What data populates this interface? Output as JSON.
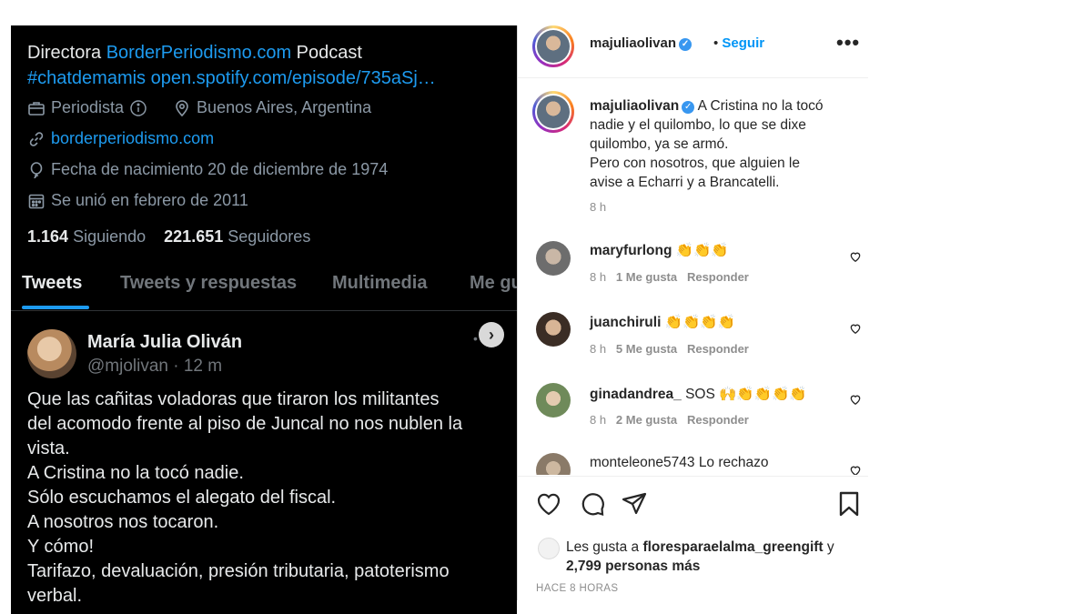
{
  "twitter": {
    "bio_line1_prefix": "Directora ",
    "bio_line1_link": "BorderPeriodismo.com",
    "bio_line1_suffix": " Podcast",
    "bio_line2": "#chatdemamis open.spotify.com/episode/735aSj…",
    "occupation": "Periodista",
    "location": "Buenos Aires, Argentina",
    "website": "borderperiodismo.com",
    "birthdate": "Fecha de nacimiento 20 de diciembre de 1974",
    "joined": "Se unió en febrero de 2011",
    "following_count": "1.164",
    "following_label": "Siguiendo",
    "followers_count": "221.651",
    "followers_label": "Seguidores",
    "tabs": [
      "Tweets",
      "Tweets y respuestas",
      "Multimedia",
      "Me gu"
    ],
    "tweet": {
      "author_name": "María Julia Oliván",
      "author_handle": "@mjolivan · 12 m",
      "lines": [
        "Que las cañitas voladoras que tiraron los militantes",
        "del acomodo frente al piso de Juncal  no nos nublen la",
        "vista.",
        "A Cristina no la tocó nadie.",
        "Sólo escuchamos el alegato del fiscal.",
        "A nosotros nos tocaron.",
        "Y cómo!",
        "Tarifazo, devaluación, presión tributaria, patoterismo",
        "verbal."
      ]
    }
  },
  "instagram": {
    "username": "majuliaolivan",
    "follow_label": "Seguir",
    "more_label": "•••",
    "caption_lines": [
      "A Cristina no la tocó",
      "nadie y el quilombo, lo que se dixe",
      "quilombo, ya se armó.",
      "Pero con nosotros, que alguien le",
      "avise a Echarri y a Brancatelli."
    ],
    "caption_time": "8 h",
    "comments": [
      {
        "user": "maryfurlong",
        "text": "👏👏👏",
        "time": "8 h",
        "likes": "1 Me gusta",
        "reply": "Responder"
      },
      {
        "user": "juanchiruli",
        "text": "👏👏👏👏",
        "time": "8 h",
        "likes": "5 Me gusta",
        "reply": "Responder"
      },
      {
        "user": "ginadandrea_",
        "text": "SOS 🙌👏👏👏👏",
        "time": "8 h",
        "likes": "2 Me gusta",
        "reply": "Responder"
      },
      {
        "user": "monteleone5743",
        "text": "Lo rechazo"
      }
    ],
    "likes_prefix": "Les gusta a ",
    "likes_user": "floresparaelalma_greengift",
    "likes_suffix": " y",
    "likes_others": "2,799 personas más",
    "post_time": "HACE 8 HORAS"
  }
}
